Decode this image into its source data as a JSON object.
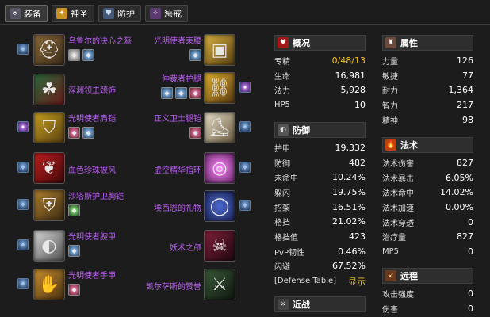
{
  "tabs": [
    {
      "label": "装备",
      "icon": "armor-icon",
      "active": true
    },
    {
      "label": "神圣",
      "icon": "holy-icon"
    },
    {
      "label": "防护",
      "icon": "shield-icon"
    },
    {
      "label": "惩戒",
      "icon": "retribution-icon"
    }
  ],
  "gear": {
    "left": [
      {
        "name": "乌鲁尔的决心之盔",
        "icon": "helmet-icon",
        "gems": [
          "meta-gem",
          "blue-gem"
        ]
      },
      {
        "name": "深渊领主颈饰",
        "icon": "neck-icon",
        "gems": []
      },
      {
        "name": "光明使者肩铠",
        "icon": "shoulder-icon",
        "gems": [
          "red-gem",
          "blue-gem"
        ]
      },
      {
        "name": "血色珍珠披风",
        "icon": "cloak-icon",
        "gems": []
      },
      {
        "name": "沙塔斯护卫胸铠",
        "icon": "chest-icon",
        "gems": [
          "green-gem"
        ]
      },
      {
        "name": "光明使者腕甲",
        "icon": "wrist-icon",
        "gems": [
          "blue-gem"
        ]
      },
      {
        "name": "光明使者手甲",
        "icon": "gloves-icon",
        "gems": [
          "red-gem"
        ]
      }
    ],
    "right": [
      {
        "name": "光明使者束腰",
        "icon": "belt-icon",
        "gems": [
          "blue-gem"
        ]
      },
      {
        "name": "仲裁者护腿",
        "icon": "legs-icon",
        "gems": [
          "blue-gem",
          "blue-gem",
          "red-gem"
        ]
      },
      {
        "name": "正义卫士腿铠",
        "icon": "boots-icon",
        "gems": [
          "red-gem"
        ]
      },
      {
        "name": "虚空精华指环",
        "icon": "ring-icon",
        "gems": []
      },
      {
        "name": "埃西恩的礼物",
        "icon": "ring-icon",
        "gems": []
      },
      {
        "name": "妖术之颅",
        "icon": "trinket-icon",
        "gems": []
      },
      {
        "name": "凯尔萨斯的赞誉",
        "icon": "trinket-icon",
        "gems": []
      }
    ]
  },
  "panels": {
    "overview": {
      "title": "概况",
      "rows": [
        {
          "k": "专精",
          "v": "0/48/13"
        },
        {
          "k": "生命",
          "v": "16,981"
        },
        {
          "k": "法力",
          "v": "5,928"
        },
        {
          "k": "HP5",
          "v": "10"
        }
      ]
    },
    "defense": {
      "title": "防御",
      "rows": [
        {
          "k": "护甲",
          "v": "19,332"
        },
        {
          "k": "防御",
          "v": "482"
        },
        {
          "k": "未命中",
          "v": "10.24%"
        },
        {
          "k": "躲闪",
          "v": "19.75%"
        },
        {
          "k": "招架",
          "v": "16.51%"
        },
        {
          "k": "格挡",
          "v": "21.02%"
        },
        {
          "k": "格挡值",
          "v": "423"
        },
        {
          "k": "PvP韧性",
          "v": "0.46%"
        },
        {
          "k": "闪避",
          "v": "67.52%"
        },
        {
          "k": "[Defense Table]",
          "v": "显示"
        }
      ]
    },
    "melee": {
      "title": "近战"
    },
    "attributes": {
      "title": "属性",
      "rows": [
        {
          "k": "力量",
          "v": "126"
        },
        {
          "k": "敏捷",
          "v": "77"
        },
        {
          "k": "耐力",
          "v": "1,364"
        },
        {
          "k": "智力",
          "v": "217"
        },
        {
          "k": "精神",
          "v": "98"
        }
      ]
    },
    "spell": {
      "title": "法术",
      "rows": [
        {
          "k": "法术伤害",
          "v": "827"
        },
        {
          "k": "法术暴击",
          "v": "6.05%"
        },
        {
          "k": "法术命中",
          "v": "14.02%"
        },
        {
          "k": "法术加速",
          "v": "0.00%"
        },
        {
          "k": "法术穿透",
          "v": "0"
        },
        {
          "k": "治疗量",
          "v": "827"
        },
        {
          "k": "MP5",
          "v": "0"
        }
      ]
    },
    "ranged": {
      "title": "远程",
      "rows": [
        {
          "k": "攻击强度",
          "v": "0"
        },
        {
          "k": "伤害",
          "v": "0"
        }
      ]
    }
  },
  "colors": {
    "gear_name": "#b860f0",
    "value_highlight": "#f0c020",
    "background": "#1c1c1c"
  }
}
